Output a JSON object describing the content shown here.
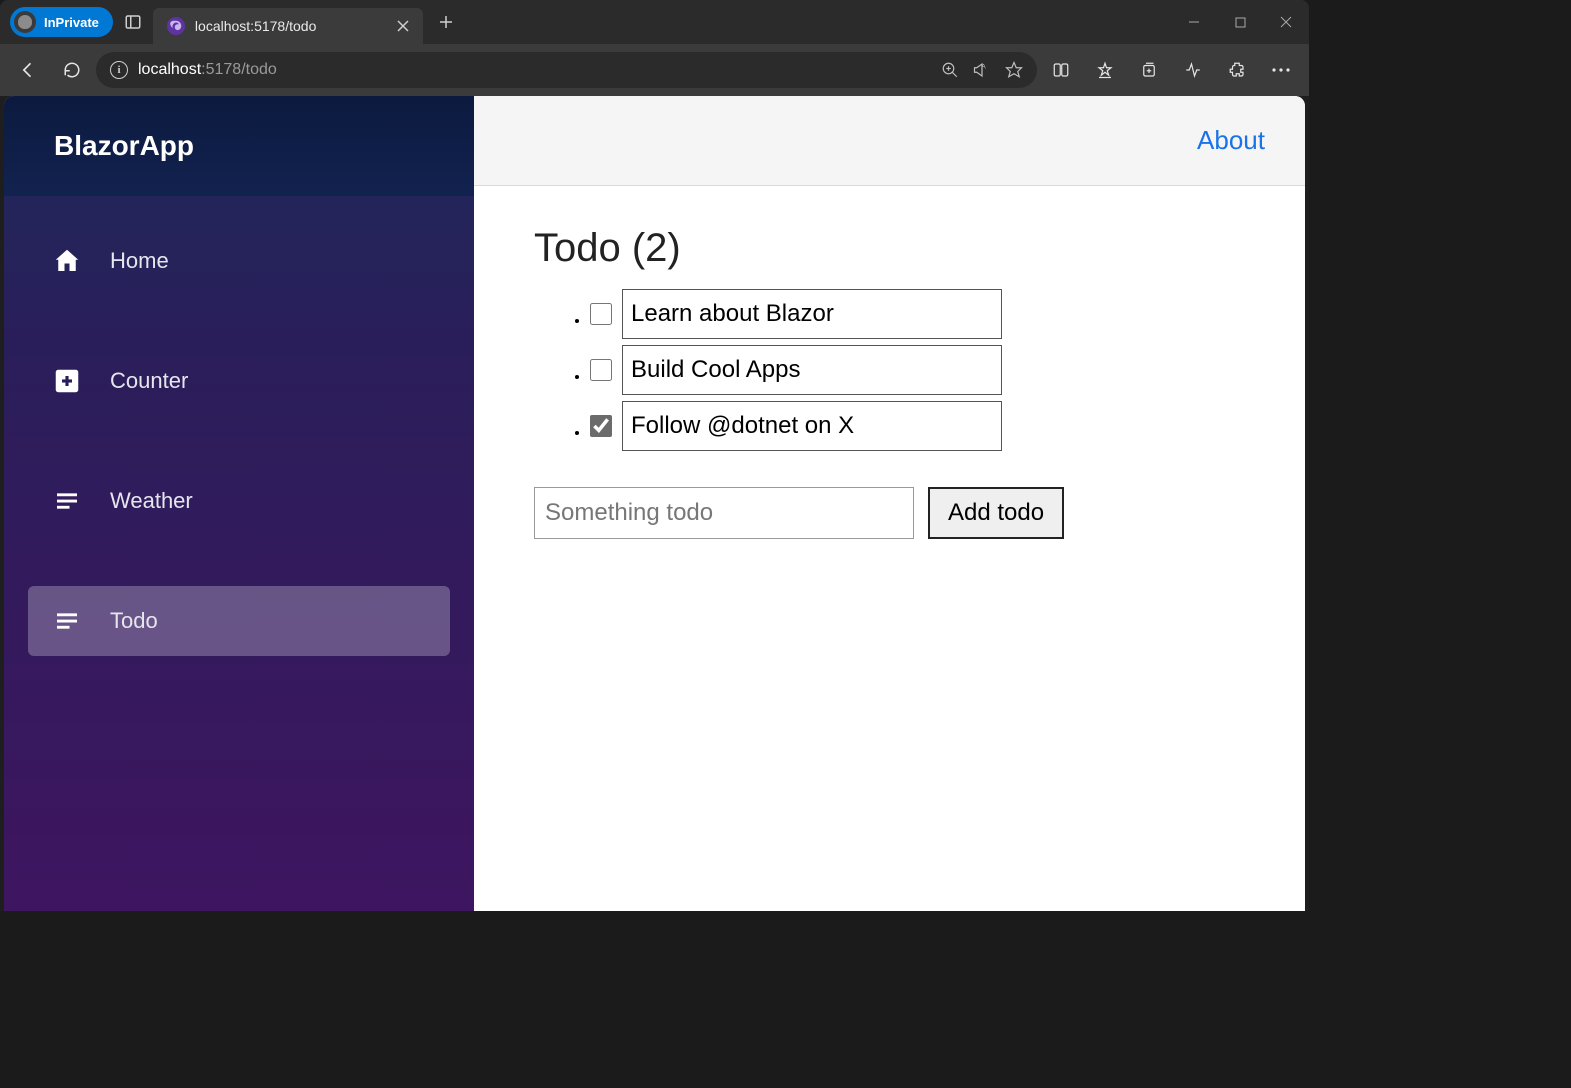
{
  "browser": {
    "private_label": "InPrivate",
    "tab_title": "localhost:5178/todo",
    "url_host": "localhost",
    "url_port_path": ":5178/todo"
  },
  "sidebar": {
    "brand": "BlazorApp",
    "items": [
      {
        "label": "Home",
        "active": false
      },
      {
        "label": "Counter",
        "active": false
      },
      {
        "label": "Weather",
        "active": false
      },
      {
        "label": "Todo",
        "active": true
      }
    ]
  },
  "header": {
    "about": "About"
  },
  "page": {
    "title": "Todo (2)",
    "add_button": "Add todo",
    "new_placeholder": "Something todo",
    "todos": [
      {
        "text": "Learn about Blazor",
        "done": false
      },
      {
        "text": "Build Cool Apps",
        "done": false
      },
      {
        "text": "Follow @dotnet on X",
        "done": true
      }
    ]
  }
}
